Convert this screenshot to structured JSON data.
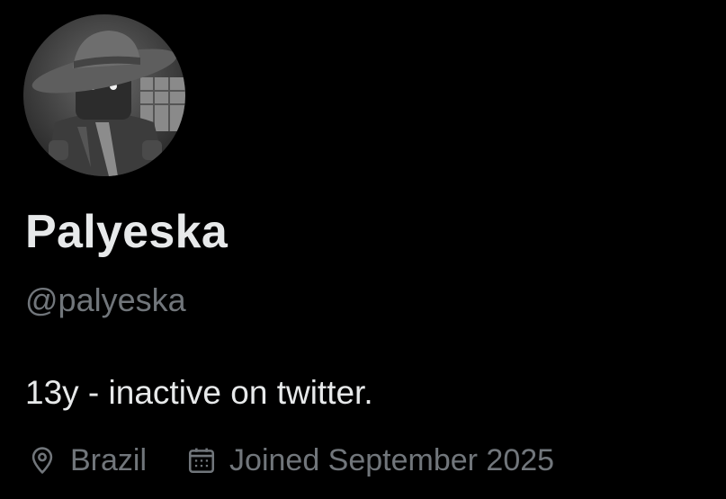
{
  "profile": {
    "display_name": "Palyeska",
    "handle": "@palyeska",
    "bio": "13y - inactive on twitter.",
    "location": "Brazil",
    "joined": "Joined September 2025",
    "avatar_icon": "profile-avatar"
  },
  "icons": {
    "location": "location-pin-icon",
    "joined": "calendar-icon"
  },
  "colors": {
    "background": "#000000",
    "primary_text": "#e7e9ea",
    "secondary_text": "#71767b"
  }
}
